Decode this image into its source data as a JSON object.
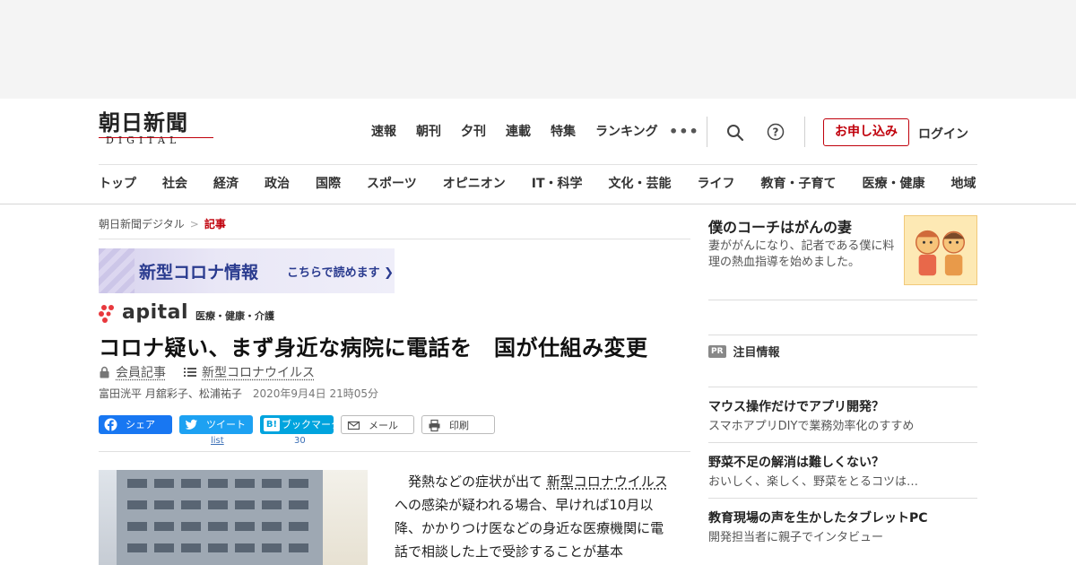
{
  "header": {
    "logo_main": "朝日新聞",
    "logo_sub": "DIGITAL",
    "top_nav": [
      "速報",
      "朝刊",
      "夕刊",
      "連載",
      "特集",
      "ランキング"
    ],
    "apply_button": "お申し込み",
    "login_link": "ログイン",
    "category_nav": [
      "トップ",
      "社会",
      "経済",
      "政治",
      "国際",
      "スポーツ",
      "オピニオン",
      "IT・科学",
      "文化・芸能",
      "ライフ",
      "教育・子育て",
      "医療・健康",
      "地域"
    ]
  },
  "breadcrumb": {
    "home": "朝日新聞デジタル",
    "sep": ">",
    "current": "記事"
  },
  "corona_banner": {
    "title": "新型コロナ情報",
    "link": "こちらで読めます"
  },
  "apital": {
    "word": "apital",
    "sub": "医療・健康・介護"
  },
  "article": {
    "headline": "コロナ疑い、まず身近な病院に電話を　国が仕組み変更",
    "member_label": "会員記事",
    "topic_label": "新型コロナウイルス",
    "authors": "富田洸平 月舘彩子、松浦祐子",
    "date": "2020年9月4日 21時05分",
    "body_prefix": "　発熱などの症状が出て ",
    "body_keyword": "新型コロナウイルス",
    "body_rest": " への感染が疑われる場合、早ければ10月以降、かかりつけ医などの身近な医療機関に電話で相談した上で受診することが基本"
  },
  "share": {
    "facebook": "シェア",
    "twitter": "ツイート",
    "hatena": "ブックマーク",
    "hatena_badge": "B!",
    "mail": "メール",
    "print": "印刷",
    "twitter_count": "list",
    "hatena_count": "30"
  },
  "sidebar": {
    "feature": {
      "title": "僕のコーチはがんの妻",
      "desc": "妻ががんになり、記者である僕に料理の熱血指導を始めました。"
    },
    "pr_badge": "PR",
    "pr_heading": "注目情報",
    "pr_items": [
      {
        "title": "マウス操作だけでアプリ開発？",
        "desc": "スマホアプリDIYで業務効率化のすすめ"
      },
      {
        "title": "野菜不足の解消は難しくない？",
        "desc": "おいしく、楽しく、野菜をとるコツは…"
      },
      {
        "title": "教育現場の声を生かしたタブレットPC",
        "desc": "開発担当者に親子でインタビュー"
      }
    ]
  },
  "colors": {
    "brand_red": "#c0000b",
    "facebook": "#1877f2",
    "twitter": "#1da1f2",
    "hatena": "#00a4de",
    "corona_text": "#2a3b8f"
  }
}
